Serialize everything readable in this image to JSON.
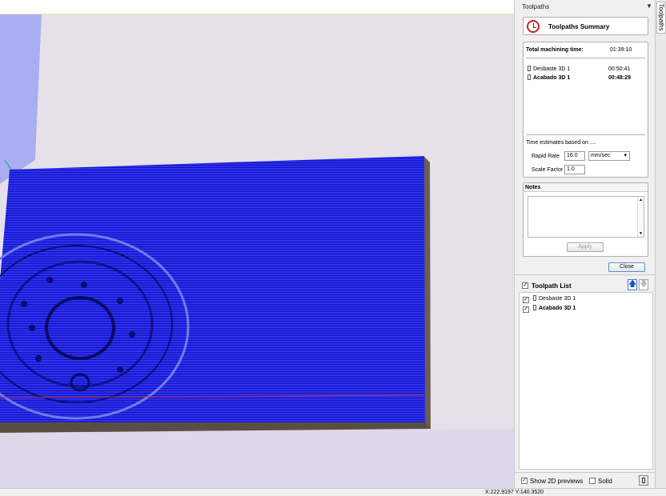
{
  "panel": {
    "title": "Toolpaths",
    "tab_label": "Toolpaths",
    "summary_title": "Toolpaths Summary"
  },
  "summary": {
    "total_label": "Total machining time:",
    "total_time": "01:39:10",
    "toolpaths": [
      {
        "name": "Desbaste 3D 1",
        "time": "00:50:41",
        "bold": false
      },
      {
        "name": "Acabado 3D 1",
        "time": "00:48:29",
        "bold": true
      }
    ],
    "estimates_label": "Time estimates based on ....",
    "rapid_rate_label": "Rapid Rate",
    "rapid_rate_value": "16.0",
    "rapid_rate_unit": "mm/sec",
    "scale_factor_label": "Scale Factor",
    "scale_factor_value": "1.0"
  },
  "notes": {
    "header": "Notes",
    "apply_label": "Apply"
  },
  "close_label": "Close",
  "toolpath_list": {
    "title": "Toolpath List",
    "items": [
      {
        "name": "Desbaste 3D 1",
        "checked": true,
        "bold": false
      },
      {
        "name": "Acabado 3D 1",
        "checked": true,
        "bold": true
      }
    ]
  },
  "bottom": {
    "show_2d_label": "Show 2D previews",
    "solid_label": "Solid"
  },
  "status": {
    "coords": "X:222.9197 Y:140.3520"
  },
  "colors": {
    "toolpath_blue": "#2a2ff0",
    "block_side": "#5a4e44",
    "viewport_bg": "#e8e4ee"
  }
}
